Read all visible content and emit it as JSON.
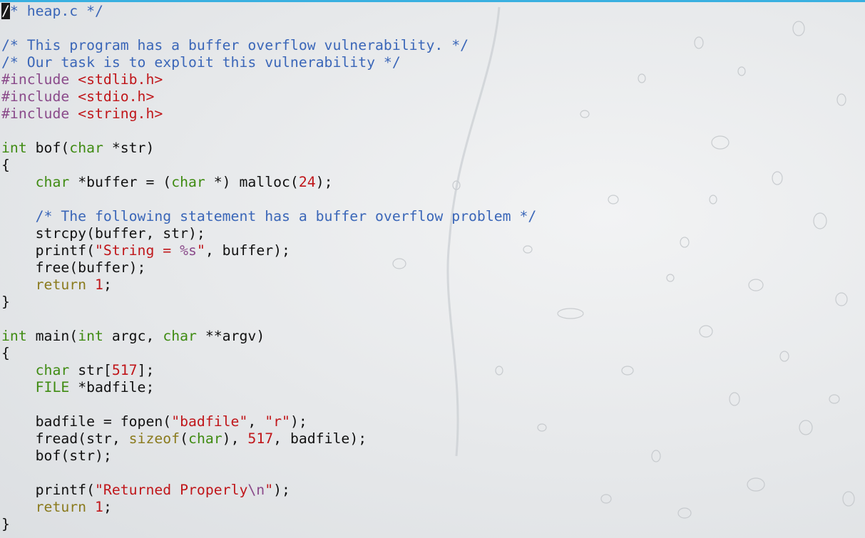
{
  "editor": {
    "file_name": "heap.c",
    "colors": {
      "text": "#111111",
      "comment": "#3a66b8",
      "preprocessor": "#8a4a8a",
      "include_path": "#c0161a",
      "type": "#3f8b12",
      "string": "#c0161a",
      "number": "#c0161a",
      "keyword": "#8a7a1d",
      "format_specifier": "#8a4a8a",
      "accent_bar": "#39b0e0"
    },
    "lines": [
      [
        [
          "cursor",
          "/"
        ],
        [
          "comment",
          "* heap.c */"
        ]
      ],
      [],
      [
        [
          "comment",
          "/* This program has a buffer overflow vulnerability. */"
        ]
      ],
      [
        [
          "comment",
          "/* Our task is to exploit this vulnerability */"
        ]
      ],
      [
        [
          "preproc",
          "#include "
        ],
        [
          "include",
          "<stdlib.h>"
        ]
      ],
      [
        [
          "preproc",
          "#include "
        ],
        [
          "include",
          "<stdio.h>"
        ]
      ],
      [
        [
          "preproc",
          "#include "
        ],
        [
          "include",
          "<string.h>"
        ]
      ],
      [],
      [
        [
          "type",
          "int"
        ],
        [
          "text",
          " bof("
        ],
        [
          "type",
          "char"
        ],
        [
          "text",
          " *str)"
        ]
      ],
      [
        [
          "text",
          "{"
        ]
      ],
      [
        [
          "text",
          "    "
        ],
        [
          "type",
          "char"
        ],
        [
          "text",
          " *buffer = ("
        ],
        [
          "type",
          "char"
        ],
        [
          "text",
          " *) malloc("
        ],
        [
          "number",
          "24"
        ],
        [
          "text",
          ");"
        ]
      ],
      [],
      [
        [
          "text",
          "    "
        ],
        [
          "comment",
          "/* The following statement has a buffer overflow problem */"
        ]
      ],
      [
        [
          "text",
          "    strcpy(buffer, str);"
        ]
      ],
      [
        [
          "text",
          "    printf("
        ],
        [
          "string",
          "\"String = "
        ],
        [
          "format",
          "%s"
        ],
        [
          "string",
          "\""
        ],
        [
          "text",
          ", buffer);"
        ]
      ],
      [
        [
          "text",
          "    free(buffer);"
        ]
      ],
      [
        [
          "text",
          "    "
        ],
        [
          "keyword",
          "return"
        ],
        [
          "text",
          " "
        ],
        [
          "number",
          "1"
        ],
        [
          "text",
          ";"
        ]
      ],
      [
        [
          "text",
          "}"
        ]
      ],
      [],
      [
        [
          "type",
          "int"
        ],
        [
          "text",
          " main("
        ],
        [
          "type",
          "int"
        ],
        [
          "text",
          " argc, "
        ],
        [
          "type",
          "char"
        ],
        [
          "text",
          " **argv)"
        ]
      ],
      [
        [
          "text",
          "{"
        ]
      ],
      [
        [
          "text",
          "    "
        ],
        [
          "type",
          "char"
        ],
        [
          "text",
          " str["
        ],
        [
          "number",
          "517"
        ],
        [
          "text",
          "];"
        ]
      ],
      [
        [
          "text",
          "    "
        ],
        [
          "type",
          "FILE"
        ],
        [
          "text",
          " *badfile;"
        ]
      ],
      [],
      [
        [
          "text",
          "    badfile = fopen("
        ],
        [
          "string",
          "\"badfile\""
        ],
        [
          "text",
          ", "
        ],
        [
          "string",
          "\"r\""
        ],
        [
          "text",
          ");"
        ]
      ],
      [
        [
          "text",
          "    fread(str, "
        ],
        [
          "keyword",
          "sizeof"
        ],
        [
          "text",
          "("
        ],
        [
          "type",
          "char"
        ],
        [
          "text",
          "), "
        ],
        [
          "number",
          "517"
        ],
        [
          "text",
          ", badfile);"
        ]
      ],
      [
        [
          "text",
          "    bof(str);"
        ]
      ],
      [],
      [
        [
          "text",
          "    printf("
        ],
        [
          "string",
          "\"Returned Properly"
        ],
        [
          "format",
          "\\n"
        ],
        [
          "string",
          "\""
        ],
        [
          "text",
          ");"
        ]
      ],
      [
        [
          "text",
          "    "
        ],
        [
          "keyword",
          "return"
        ],
        [
          "text",
          " "
        ],
        [
          "number",
          "1"
        ],
        [
          "text",
          ";"
        ]
      ],
      [
        [
          "text",
          "}"
        ]
      ]
    ]
  }
}
